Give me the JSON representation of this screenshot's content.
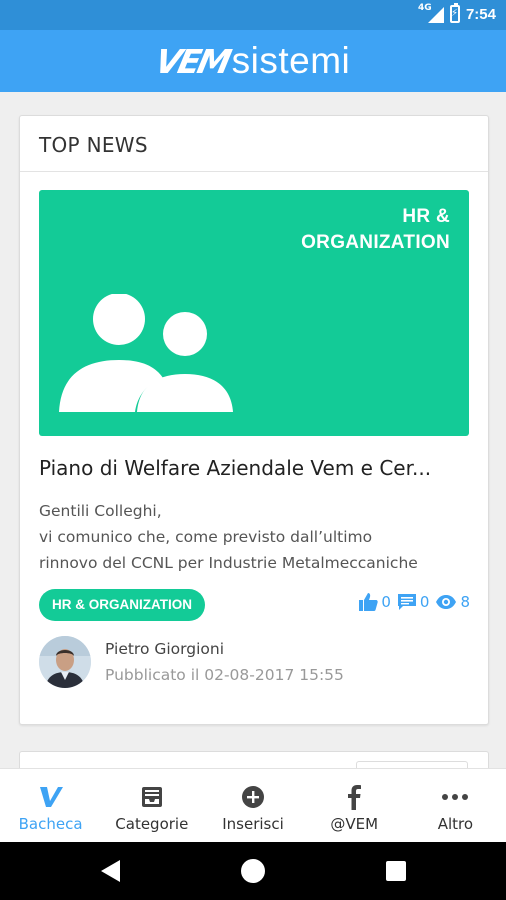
{
  "status_bar": {
    "network": "4G",
    "time": "7:54"
  },
  "app_bar": {
    "logo_brand": "VEM",
    "logo_word": "sistemi"
  },
  "top_news": {
    "header": "TOP NEWS",
    "banner": {
      "line1": "HR &",
      "line2": "ORGANIZATION",
      "color": "#13cb97",
      "icon": "people-icon"
    },
    "post": {
      "title": "Piano di Welfare Aziendale Vem e Cer...",
      "excerpt": [
        "Gentili Colleghi,",
        "vi comunico che, come previsto dall’ultimo",
        "rinnovo del CCNL per Industrie Metalmeccaniche"
      ],
      "category": "HR & ORGANIZATION",
      "likes": "0",
      "comments": "0",
      "views": "8",
      "author": "Pietro Giorgioni",
      "published": "Pubblicato il 02-08-2017 15:55"
    }
  },
  "tabs": [
    {
      "label": "Bacheca",
      "icon": "bacheca-v-icon",
      "active": true
    },
    {
      "label": "Categorie",
      "icon": "categories-icon",
      "active": false
    },
    {
      "label": "Inserisci",
      "icon": "add-circle-icon",
      "active": false
    },
    {
      "label": "@VEM",
      "icon": "facebook-icon",
      "active": false
    },
    {
      "label": "Altro",
      "icon": "more-dots-icon",
      "active": false
    }
  ],
  "colors": {
    "status_bar": "#2f8fd7",
    "app_bar": "#3ea3f4",
    "accent_green": "#13cb97",
    "accent_blue": "#3ea3f4"
  }
}
